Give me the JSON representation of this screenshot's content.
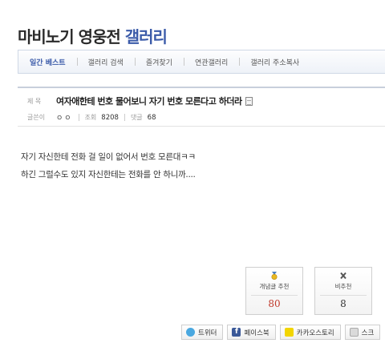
{
  "header": {
    "title_main": "마비노기 영웅전",
    "title_accent": "갤러리"
  },
  "tabs": [
    {
      "label": "일간 베스트",
      "active": true
    },
    {
      "label": "갤러리 검색",
      "active": false
    },
    {
      "label": "즐겨찾기",
      "active": false
    },
    {
      "label": "연관갤러리",
      "active": false
    },
    {
      "label": "갤러리 주소복사",
      "active": false
    }
  ],
  "post": {
    "subject_label": "제 목",
    "subject": "여자애한테 번호 물어보니 자기 번호 모른다고 하더라",
    "author_label": "글쓴이",
    "author": "ㅇㅇ",
    "views_label": "조회",
    "views": "8208",
    "comments_label": "댓글",
    "comments": "68",
    "body_lines": [
      "자기 자신한테 전화 걸 일이 없어서 번호 모른대ㅋㅋ",
      "하긴 그럴수도 있지 자신한테는 전화를 안 하니까...."
    ]
  },
  "votes": {
    "up_label": "개념글 추천",
    "up_count": "80",
    "down_label": "비추천",
    "down_count": "8",
    "up_color": "#c0392b"
  },
  "share": [
    {
      "label": "트위터",
      "icon": "twitter-icon"
    },
    {
      "label": "페이스북",
      "icon": "facebook-icon"
    },
    {
      "label": "카카오스토리",
      "icon": "kakaostory-icon"
    },
    {
      "label": "스크",
      "icon": "scrap-icon"
    }
  ],
  "colors": {
    "accent": "#3b5ba9",
    "vote_up": "#c0392b"
  }
}
